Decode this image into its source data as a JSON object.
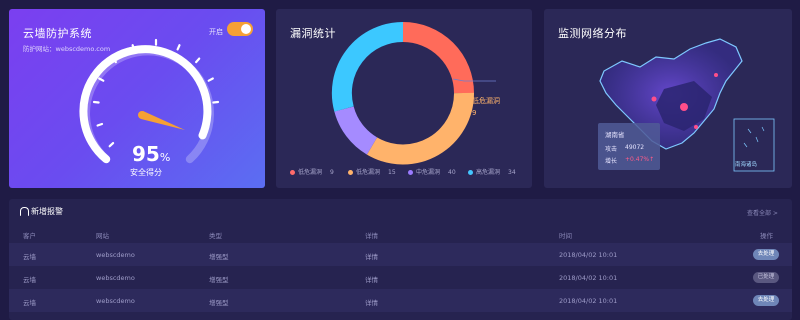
{
  "protect": {
    "title": "云墙防护系统",
    "site_label": "防护网站：webscdemo.com",
    "toggle_label": "开启",
    "score": "95",
    "percent": "%",
    "score_label": "安全得分",
    "colors": {
      "needle": "#f6a035"
    }
  },
  "vuln": {
    "title": "漏洞统计",
    "callout_label": "低危漏洞",
    "callout_value": "9",
    "legend": [
      {
        "label": "低危漏洞",
        "count": "9",
        "color": "#ff6b6b"
      },
      {
        "label": "低危漏洞",
        "count": "15",
        "color": "#ffb36b"
      },
      {
        "label": "中危漏洞",
        "count": "40",
        "color": "#9b7bff"
      },
      {
        "label": "高危漏洞",
        "count": "34",
        "color": "#44c6ff"
      }
    ]
  },
  "map": {
    "title": "监测网络分布",
    "tooltip": {
      "province": "湖南省",
      "attack_label": "攻击",
      "attack_value": "49072",
      "growth_label": "增长",
      "growth_value": "+0.47%↑"
    },
    "inset_label": "南海诸岛"
  },
  "alerts": {
    "title": "新增报警",
    "view_all": "查看全部 >",
    "headers": [
      "客户",
      "网站",
      "类型",
      "详情",
      "时间",
      "操作"
    ],
    "rows": [
      {
        "client": "云墙",
        "site": "webscdemo",
        "type": "增强型",
        "detail": "详情",
        "time": "2018/04/02 10:01",
        "action": "去处理",
        "state": "pending"
      },
      {
        "client": "云墙",
        "site": "webscdemo",
        "type": "增强型",
        "detail": "详情",
        "time": "2018/04/02 10:01",
        "action": "已处理",
        "state": "done"
      },
      {
        "client": "云墙",
        "site": "webscdemo",
        "type": "增强型",
        "detail": "详情",
        "time": "2018/04/02 10:01",
        "action": "去处理",
        "state": "pending"
      }
    ]
  }
}
